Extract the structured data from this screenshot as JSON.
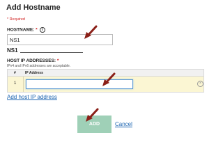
{
  "form": {
    "title": "Add Hostname",
    "required_note": "* Required",
    "hostname_label": "HOSTNAME:",
    "required_star": "*",
    "info_icon_glyph": "i",
    "hostname_value": "NS1",
    "hostname_preview": "NS1",
    "ip_label": "HOST IP ADDRESSES:",
    "ip_hint": "IPv4 and IPv6 addresses are acceptable.",
    "ip_table": {
      "headers": [
        "#",
        "IP Address"
      ],
      "rows": [
        {
          "num": "1",
          "value": ""
        }
      ]
    },
    "add_host_ip_link": "Add host IP address",
    "add_button": "ADD",
    "cancel_link": "Cancel",
    "remove_icon_glyph": "×"
  },
  "colors": {
    "accent_link": "#1a63b0",
    "required": "#d22222",
    "add_button_bg": "#9fd0b7",
    "row_highlight": "#fbf6d3",
    "annotation_arrow": "#8b2018"
  }
}
